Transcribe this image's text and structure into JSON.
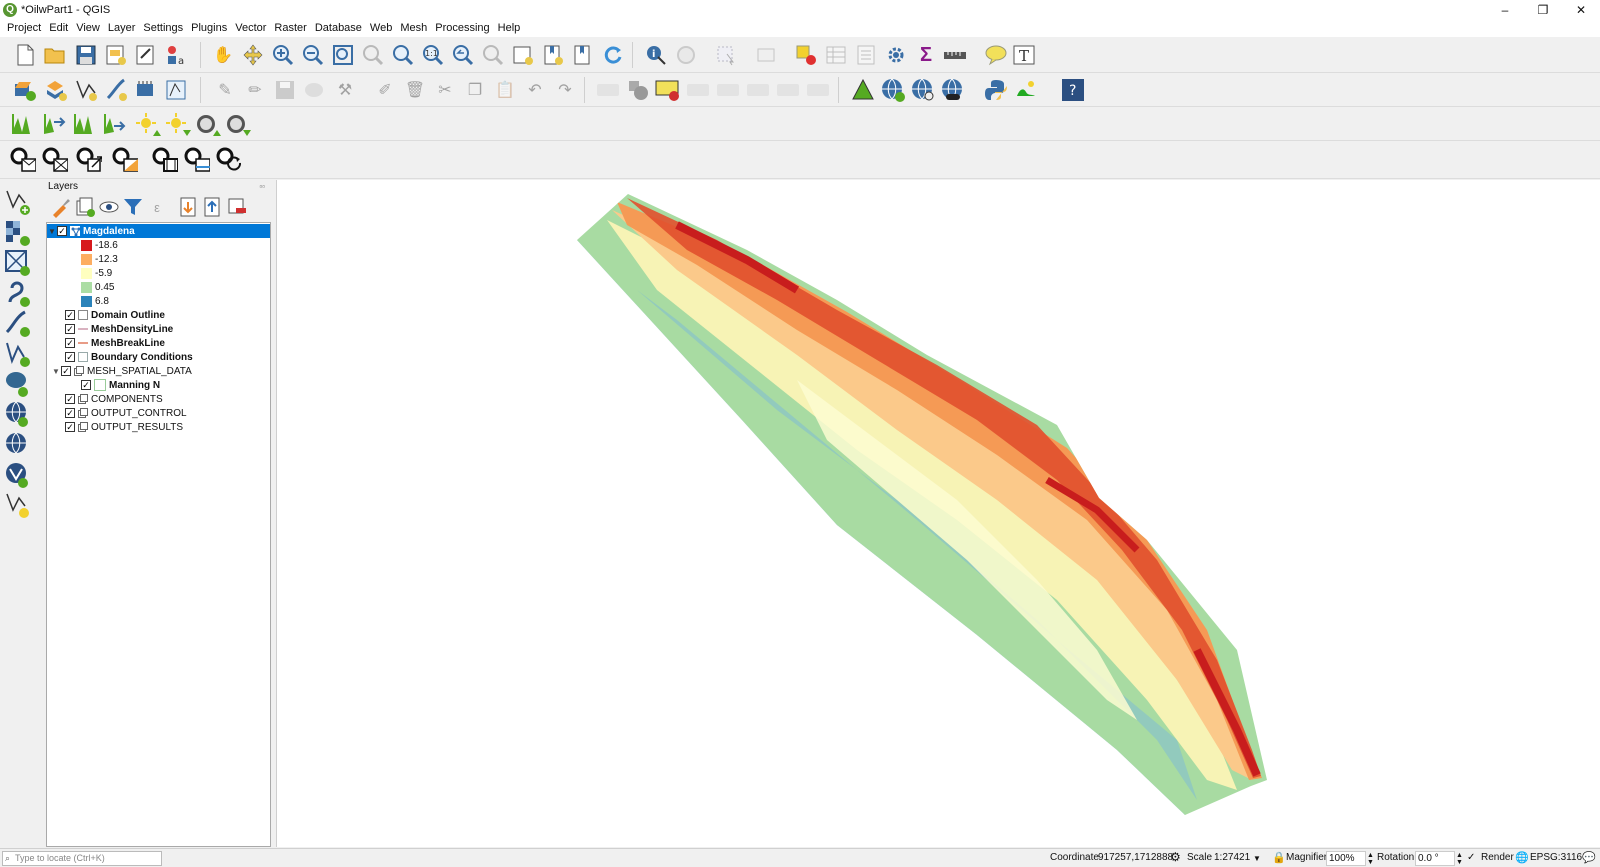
{
  "window": {
    "title": "*OilwPart1 - QGIS",
    "minimize": "–",
    "restore": "❐",
    "close": "✕"
  },
  "menu": [
    "Project",
    "Edit",
    "View",
    "Layer",
    "Settings",
    "Plugins",
    "Vector",
    "Raster",
    "Database",
    "Web",
    "Mesh",
    "Processing",
    "Help"
  ],
  "layers_panel": {
    "title": "Layers",
    "items": [
      {
        "label": "Magdalena",
        "checked": true,
        "selected": true
      },
      {
        "label": "-18.6",
        "color": "#d7191c"
      },
      {
        "label": "-12.3",
        "color": "#fdae61"
      },
      {
        "label": "-5.9",
        "color": "#ffffbf"
      },
      {
        "label": "0.45",
        "color": "#abdda4"
      },
      {
        "label": "6.8",
        "color": "#2b83ba"
      },
      {
        "label": "Domain Outline",
        "checked": true
      },
      {
        "label": "MeshDensityLine",
        "checked": true
      },
      {
        "label": "MeshBreakLine",
        "checked": true
      },
      {
        "label": "Boundary Conditions",
        "checked": true
      },
      {
        "label": "MESH_SPATIAL_DATA",
        "checked": true
      },
      {
        "label": "Manning N",
        "checked": true
      },
      {
        "label": "COMPONENTS",
        "checked": true
      },
      {
        "label": "OUTPUT_CONTROL",
        "checked": true
      },
      {
        "label": "OUTPUT_RESULTS",
        "checked": true
      }
    ]
  },
  "status": {
    "locator_placeholder": "Type to locate (Ctrl+K)",
    "coordinate_label": "Coordinate",
    "coordinate_value": "917257,1712888",
    "scale_label": "Scale",
    "scale_value": "1:27421",
    "magnifier_label": "Magnifier",
    "magnifier_value": "100%",
    "rotation_label": "Rotation",
    "rotation_value": "0.0 °",
    "render_label": "Render",
    "crs": "EPSG:3116"
  },
  "colors": {
    "selection": "#0078d7",
    "ramp": [
      "#d7191c",
      "#fdae61",
      "#ffffbf",
      "#abdda4",
      "#2b83ba"
    ]
  },
  "icons": {
    "toolbar1": [
      "new-project-icon",
      "open-project-icon",
      "save-project-icon",
      "new-print-layout-icon",
      "layout-manager-icon",
      "style-manager-icon",
      "pan-icon",
      "pan-to-selection-icon",
      "zoom-in-icon",
      "zoom-out-icon",
      "zoom-full-icon",
      "zoom-to-selection-icon",
      "zoom-to-layer-icon",
      "zoom-native-icon",
      "zoom-last-icon",
      "zoom-next-icon",
      "new-map-view-icon",
      "new-bookmark-icon",
      "show-bookmarks-icon",
      "refresh-icon",
      "identify-icon",
      "action-icon",
      "select-features-icon",
      "open-attribute-table-icon",
      "deselect-icon",
      "field-calculator-icon",
      "statistics-icon",
      "processing-toolbox-icon",
      "sum-icon",
      "measure-icon",
      "map-tips-icon",
      "text-annotation-icon"
    ],
    "toolbar2": [
      "add-vector-layer-icon",
      "add-raster-layer-icon",
      "add-delimited-text-icon",
      "add-spatialite-icon",
      "add-gpx-icon",
      "new-shapefile-icon",
      "toggle-editing-icon",
      "digitize-icon",
      "save-edits-icon",
      "add-feature-icon",
      "vertex-tool-icon",
      "modify-attributes-icon",
      "delete-icon",
      "cut-icon",
      "copy-icon",
      "paste-icon",
      "undo-icon",
      "redo-icon",
      "label-tool-icon",
      "diagram-icon",
      "label-highlight-icon",
      "pin-label-icon",
      "show-label-icon",
      "move-label-icon",
      "rotate-label-icon",
      "change-label-icon",
      "triangle-icon",
      "globe-plus-icon",
      "globe-search-icon",
      "globe-binoculars-icon",
      "python-icon",
      "mesh-shape-icon",
      "help-icon"
    ],
    "toolbar3": [
      "profile-icon",
      "profile-arrows-icon",
      "profile-2-icon",
      "profile-3-icon",
      "sun-up-icon",
      "sun-down-icon",
      "circle-up-icon",
      "circle-down-icon"
    ],
    "toolbar4": [
      "mesh-new-icon",
      "mesh-delete-icon",
      "mesh-export-icon",
      "mesh-edit-icon",
      "mesh-frame-icon",
      "mesh-check-icon",
      "mesh-refresh-icon"
    ],
    "left": [
      "add-vector-icon",
      "add-raster-icon",
      "add-mesh-icon",
      "add-delimited-icon",
      "add-spatialite-icon",
      "add-virtual-icon",
      "add-postgis-icon",
      "add-wms-icon",
      "add-wfs-icon",
      "add-wcs-icon",
      "add-temp-icon"
    ]
  }
}
